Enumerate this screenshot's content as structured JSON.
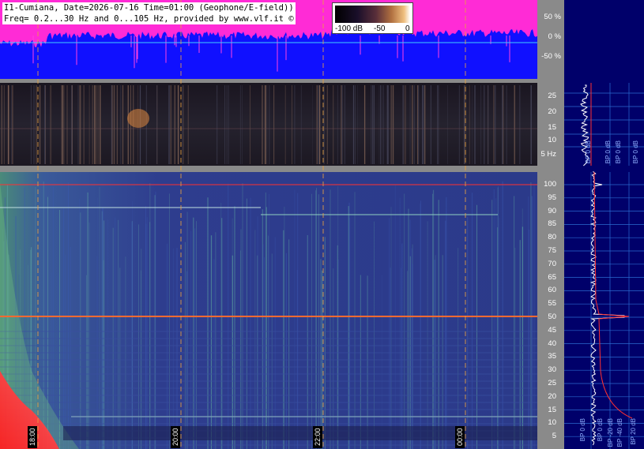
{
  "header": {
    "line1": "I1-Cumiana, Date=2026-07-16 Time=01:00 (Geophone/E-field))",
    "line2": "Freq= 0.2...30 Hz and 0...105 Hz, provided by www.vlf.it ©"
  },
  "colorbar": {
    "labels": [
      "-100 dB",
      "-50",
      "0"
    ]
  },
  "time_labels": [
    "18:00",
    "20:00",
    "22:00",
    "00:00"
  ],
  "colors": {
    "page_bg": "#ffffff",
    "right_bg": "#00006a",
    "sep": "#8a8a8a",
    "level_magenta": "#ff2bd6",
    "level_blue": "#1010ff",
    "spec_low_bg": "#1a1a2e",
    "spec_high_bg": "#2b3a8e",
    "line_red": "#ff3030",
    "line_orange": "#e8a040"
  },
  "chart_data": [
    {
      "type": "area",
      "panel": "percentage level",
      "y_ticks": [
        "50 %",
        "0 %",
        "-50 %"
      ],
      "ylim": [
        -100,
        100
      ]
    },
    {
      "type": "heatmap",
      "panel": "0.2-30 Hz spectrogram",
      "y_ticks": [
        "25",
        "20",
        "15",
        "10",
        "5 Hz"
      ],
      "ylim": [
        0.2,
        30
      ],
      "bp_labels": [
        "BP 0 dB",
        "BP 0 dB",
        "BP 0 dB",
        "BP 0 dB"
      ]
    },
    {
      "type": "heatmap",
      "panel": "0-105 Hz spectrogram",
      "y_ticks": [
        "100",
        "95",
        "90",
        "85",
        "80",
        "75",
        "70",
        "65",
        "60",
        "55",
        "50",
        "45",
        "40",
        "35",
        "30",
        "25",
        "20",
        "15",
        "10",
        "5"
      ],
      "ylim": [
        0,
        105
      ],
      "bp_labels": [
        "BP 0 dB",
        "BP 0 dB",
        "BP -20 dB",
        "BP -40 dB",
        "BP 20 dB"
      ]
    }
  ]
}
